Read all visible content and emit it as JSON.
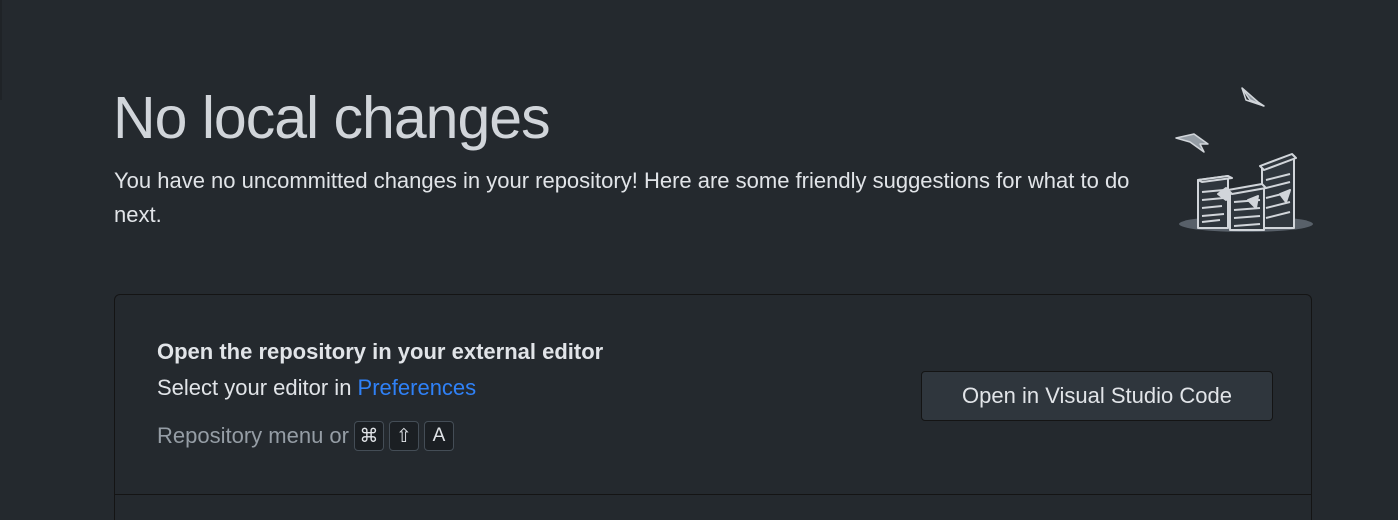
{
  "header": {
    "title": "No local changes",
    "subtitle": "You have no uncommitted changes in your repository! Here are some friendly suggestions for what to do next."
  },
  "illustration": {
    "icon": "paper-stacks-illustration"
  },
  "suggestion": {
    "title": "Open the repository in your external editor",
    "desc_prefix": "Select your editor in ",
    "preferences_link": "Preferences",
    "shortcut_prefix": "Repository menu or",
    "keys": [
      "⌘",
      "⇧",
      "A"
    ],
    "button_label": "Open in Visual Studio Code"
  },
  "colors": {
    "background": "#24292e",
    "link": "#2f81f7",
    "text": "#e1e4e8",
    "muted": "#959da5"
  }
}
